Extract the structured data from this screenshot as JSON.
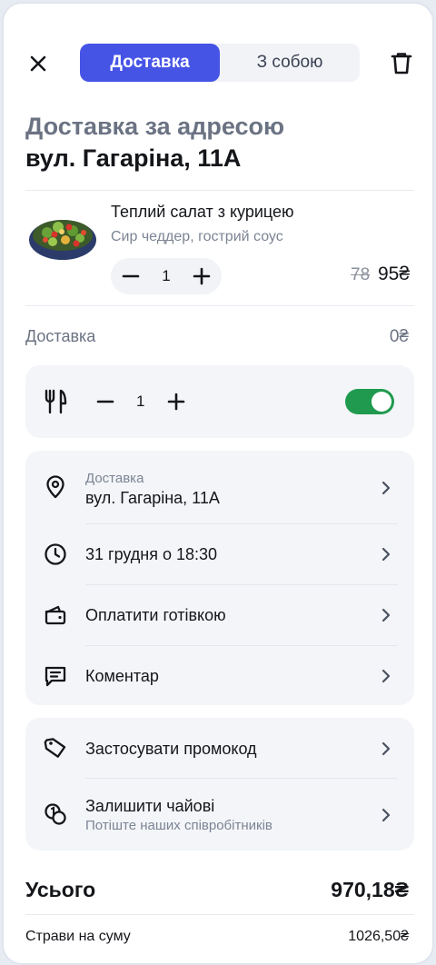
{
  "header": {
    "tabs": [
      {
        "label": "Доставка",
        "active": true
      },
      {
        "label": "З собою",
        "active": false
      }
    ]
  },
  "title": {
    "line1": "Доставка за адресою",
    "line2": "вул. Гагаріна, 11А"
  },
  "cart": {
    "items": [
      {
        "name": "Теплий салат з курицею",
        "description": "Сир чеддер, гострий соус",
        "quantity": "1",
        "old_price": "78",
        "price": "95₴"
      }
    ]
  },
  "delivery": {
    "label": "Доставка",
    "value": "0₴"
  },
  "cutlery": {
    "quantity": "1",
    "enabled": true,
    "accent_color": "#1f9a4f"
  },
  "options": [
    {
      "icon": "location-pin-icon",
      "label": "Доставка",
      "value": "вул. Гагаріна, 11А"
    },
    {
      "icon": "clock-icon",
      "label": "31 грудня о 18:30"
    },
    {
      "icon": "wallet-icon",
      "label": "Оплатити готівкою"
    },
    {
      "icon": "comment-icon",
      "label": "Коментар"
    }
  ],
  "extras": [
    {
      "icon": "tag-icon",
      "label": "Застосувати промокод"
    },
    {
      "icon": "coins-icon",
      "label": "Залишити чайові",
      "subtitle": "Потіште наших співробітників"
    }
  ],
  "summary": {
    "total_label": "Усього",
    "total_value": "970,18₴",
    "dishes_label": "Страви на суму",
    "dishes_value": "1026,50₴"
  },
  "colors": {
    "primary": "#4654e6",
    "toggle_on": "#1f9a4f",
    "muted_text": "#6b7383"
  }
}
